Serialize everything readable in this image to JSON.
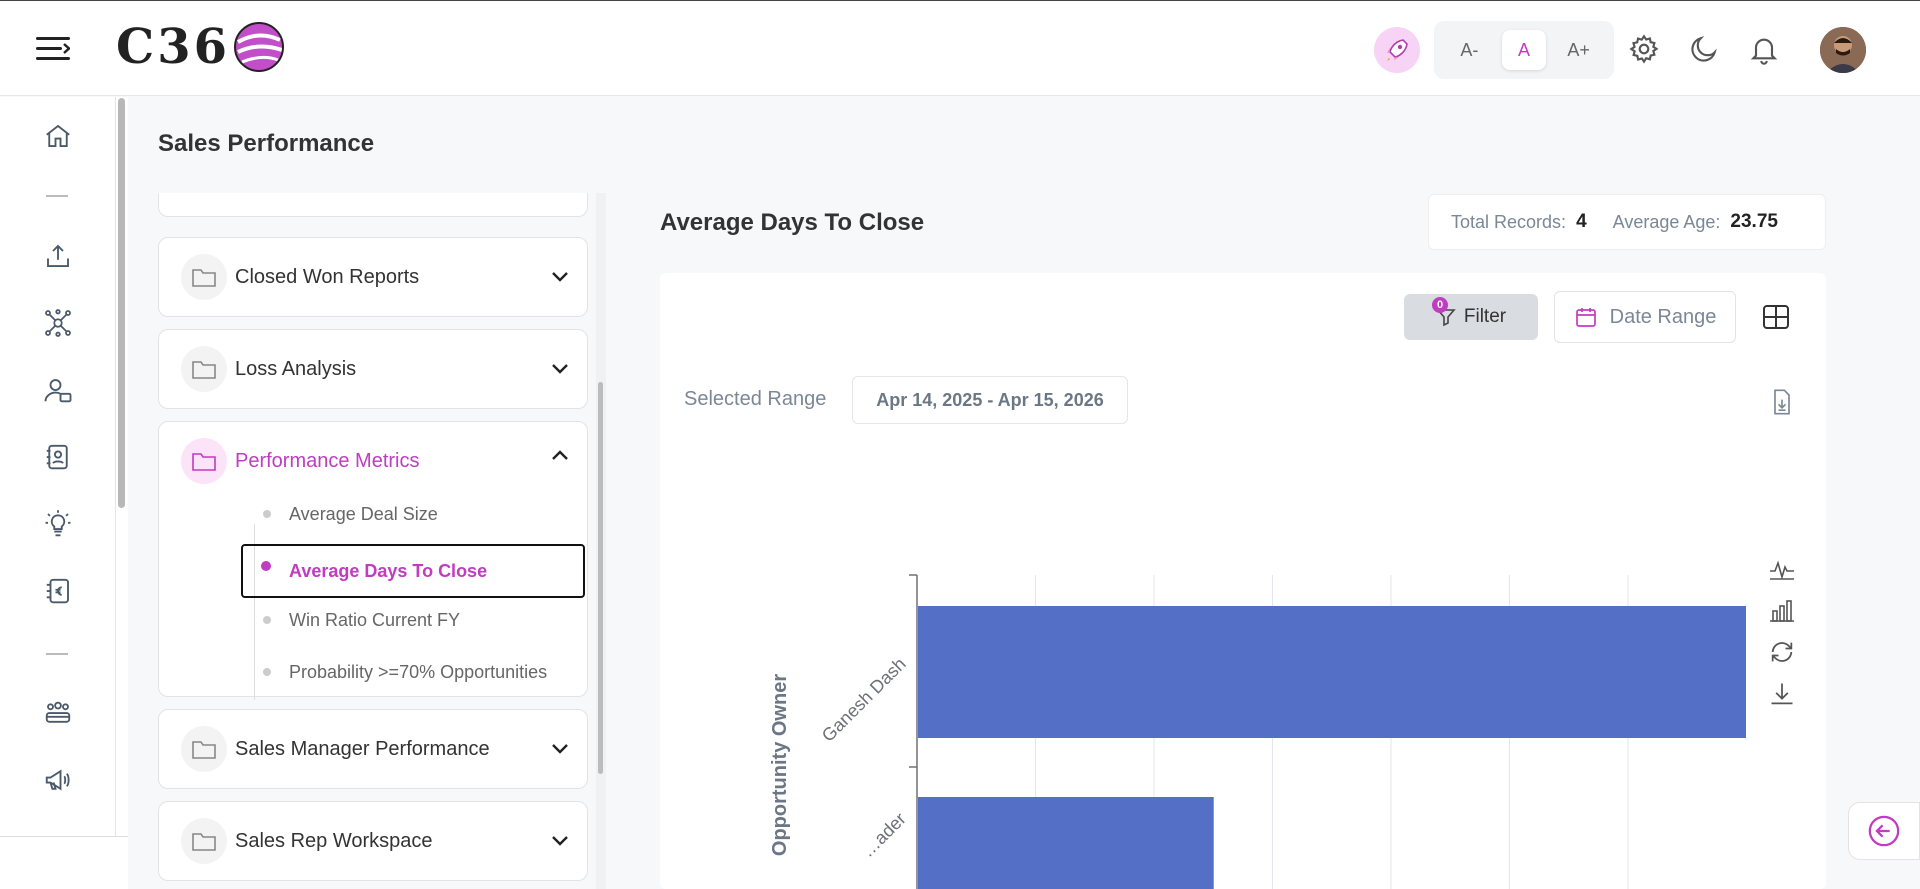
{
  "header": {
    "logo_text": "C36",
    "font_sizes": [
      "A-",
      "A",
      "A+"
    ],
    "active_font_size": "A"
  },
  "page": {
    "title": "Sales Performance"
  },
  "tree": {
    "cards": [
      {
        "label": "Closed Won Reports",
        "expanded": false
      },
      {
        "label": "Loss Analysis",
        "expanded": false
      },
      {
        "label": "Performance Metrics",
        "expanded": true,
        "items": [
          "Average Deal Size",
          "Average Days To Close",
          "Win Ratio Current FY",
          "Probability >=70% Opportunities"
        ],
        "active_item": "Average Days To Close"
      },
      {
        "label": "Sales Manager Performance",
        "expanded": false
      },
      {
        "label": "Sales Rep Workspace",
        "expanded": false
      }
    ]
  },
  "report": {
    "title": "Average Days To Close",
    "total_records_label": "Total Records:",
    "total_records": "4",
    "average_age_label": "Average Age:",
    "average_age": "23.75",
    "filter_label": "Filter",
    "filter_count": "0",
    "date_range_label": "Date Range",
    "selected_range_label": "Selected Range",
    "selected_range_value": "Apr 14, 2025 - Apr 15, 2026"
  },
  "chart_data": {
    "type": "bar",
    "orientation": "horizontal",
    "categories": [
      "Ganesh Dash",
      "…ader"
    ],
    "values": [
      70,
      25
    ],
    "ylabel": "Opportunity Owner",
    "color": "#5470c6",
    "grid": true
  },
  "colors": {
    "accent": "#c03cc0",
    "bar": "#5470c6"
  }
}
